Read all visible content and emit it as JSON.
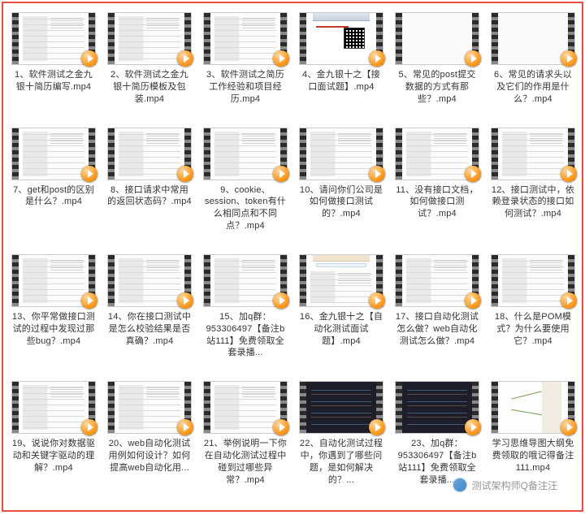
{
  "watermark": "测试架构师Q备注汪",
  "items": [
    {
      "label": "1、软件测试之金九银十简历编写.mp4",
      "style": "doc"
    },
    {
      "label": "2、软件测试之金九银十简历模板及包装.mp4",
      "style": "doc"
    },
    {
      "label": "3、软件测试之简历工作经验和项目经历.mp4",
      "style": "doc"
    },
    {
      "label": "4、金九银十之【接口面试题】.mp4",
      "style": "web"
    },
    {
      "label": "5、常见的post提交数据的方式有那些？.mp4",
      "style": "blank"
    },
    {
      "label": "6、常见的请求头以及它们的作用是什么？.mp4",
      "style": "blank"
    },
    {
      "label": "7、get和post的区别是什么？.mp4",
      "style": "doc"
    },
    {
      "label": "8、接口请求中常用的返回状态码？.mp4",
      "style": "doc"
    },
    {
      "label": "9、cookie、session、token有什么相同点和不同点？.mp4",
      "style": "doc"
    },
    {
      "label": "10、请问你们公司是如何做接口测试的？.mp4",
      "style": "doc"
    },
    {
      "label": "11、没有接口文档，如何做接口测试？.mp4",
      "style": "doc"
    },
    {
      "label": "12、接口测试中，依赖登录状态的接口如何测试？.mp4",
      "style": "doc"
    },
    {
      "label": "13、你平常做接口测试的过程中发现过那些bug？.mp4",
      "style": "doc"
    },
    {
      "label": "14、你在接口测试中是怎么校验结果是否真确？.mp4",
      "style": "doc"
    },
    {
      "label": "15、加q群：953306497【备注b站111】免费领取全套录播...",
      "style": "doc"
    },
    {
      "label": "16、金九银十之【自动化测试面试题】.mp4",
      "style": "browser"
    },
    {
      "label": "17、接口自动化测试怎么做？web自动化测试怎么做？.mp4",
      "style": "doc"
    },
    {
      "label": "18、什么是POM模式？为什么要使用它？.mp4",
      "style": "doc"
    },
    {
      "label": "19、说说你对数据驱动和关键字驱动的理解？.mp4",
      "style": "doc"
    },
    {
      "label": "20、web自动化测试用例如何设计？如何提高web自动化用...",
      "style": "doc"
    },
    {
      "label": "21、举例说明一下你在自动化测试过程中碰到过哪些异常？.mp4",
      "style": "doc"
    },
    {
      "label": "22、自动化测试过程中，你遇到了哪些问题，是如何解决的？...",
      "style": "dark"
    },
    {
      "label": "23、加q群：953306497【备注b站111】免费领取全套录播...",
      "style": "dark"
    },
    {
      "label": "学习思维导图大纲免费领取的哦记得备注111.mp4",
      "style": "mind"
    }
  ]
}
